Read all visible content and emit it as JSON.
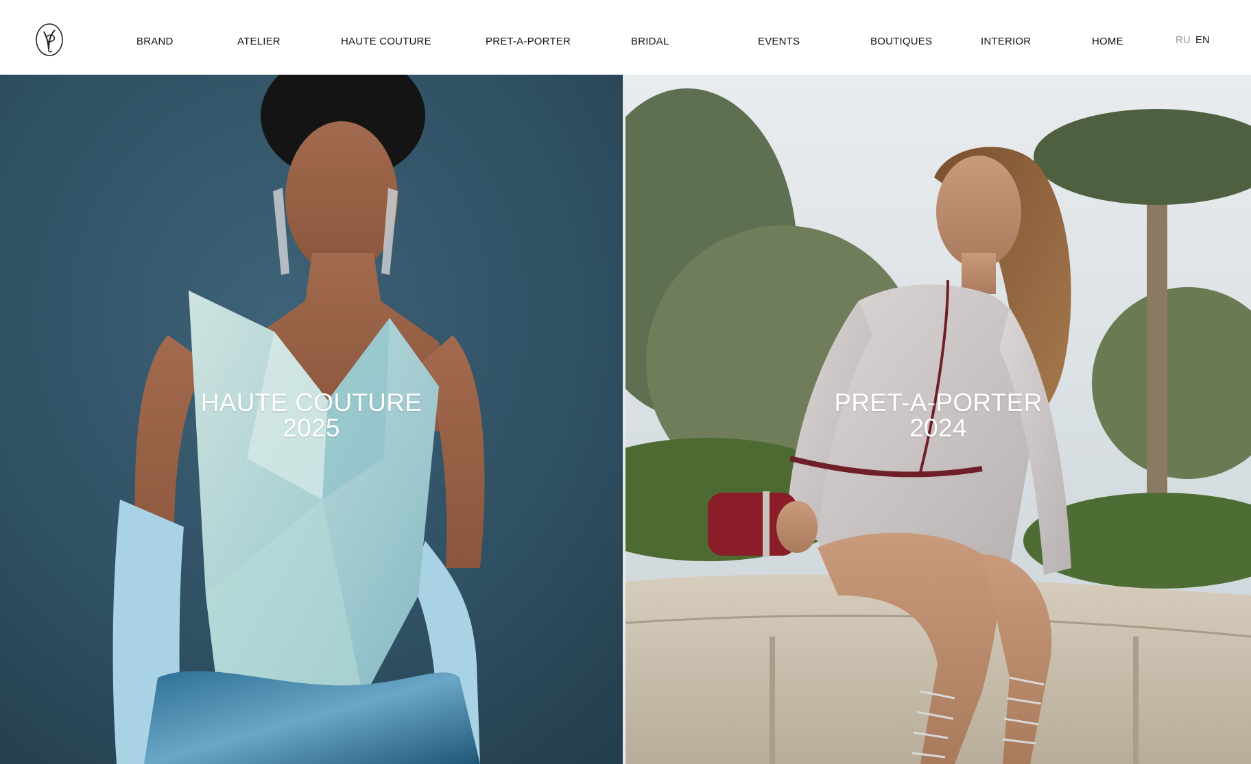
{
  "header": {
    "logo_alt": "Brand monogram",
    "nav": [
      {
        "label": "BRAND"
      },
      {
        "label": "ATELIER"
      },
      {
        "label": "HAUTE COUTURE"
      },
      {
        "label": "PRET-A-PORTER"
      },
      {
        "label": "BRIDAL"
      },
      {
        "label": "EVENTS"
      },
      {
        "label": "BOUTIQUES"
      },
      {
        "label": "INTERIOR"
      },
      {
        "label": "HOME"
      }
    ],
    "languages": [
      {
        "code": "RU",
        "active": false
      },
      {
        "code": "EN",
        "active": true
      }
    ]
  },
  "panels": {
    "left": {
      "title": "HAUTE COUTURE",
      "year": "2025",
      "image": "model-in-pale-blue-corset-gown"
    },
    "right": {
      "title": "PRET-A-PORTER",
      "year": "2024",
      "image": "model-in-grey-wrap-dress-seated"
    }
  },
  "colors": {
    "left_background": "#2f4f62",
    "right_sky": "#dfe3e6",
    "text_on_image": "#ffffff",
    "nav_text": "#111111",
    "lang_inactive": "#9a9a9a"
  }
}
